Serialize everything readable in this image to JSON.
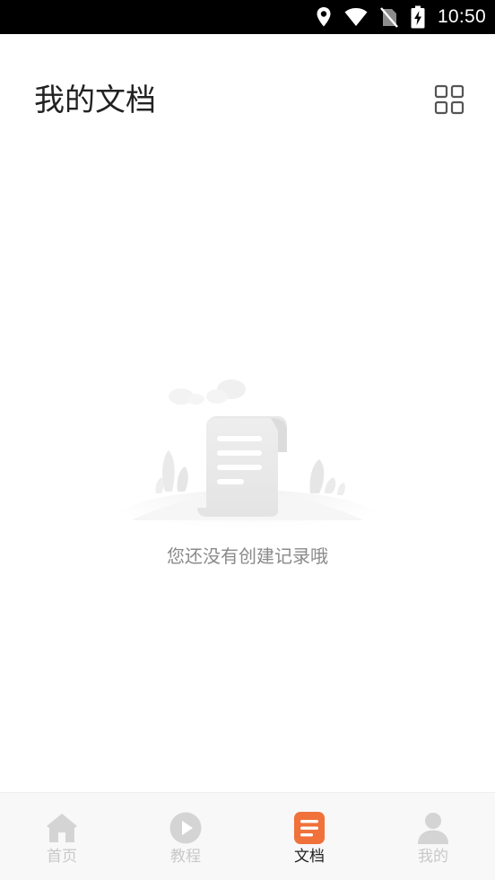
{
  "status_bar": {
    "time": "10:50",
    "icons": [
      "location-icon",
      "wifi-icon",
      "no-sim-icon",
      "battery-charging-icon"
    ]
  },
  "header": {
    "title": "我的文档",
    "view_toggle_icon": "grid-view-icon"
  },
  "empty_state": {
    "illustration_icon": "empty-document-icon",
    "message": "您还没有创建记录哦"
  },
  "bottom_nav": {
    "active_color": "#f0713a",
    "inactive_color": "#d4d4d4",
    "items": [
      {
        "label": "首页",
        "icon": "home-icon",
        "active": false
      },
      {
        "label": "教程",
        "icon": "play-icon",
        "active": false
      },
      {
        "label": "文档",
        "icon": "document-icon",
        "active": true
      },
      {
        "label": "我的",
        "icon": "person-icon",
        "active": false
      }
    ]
  }
}
